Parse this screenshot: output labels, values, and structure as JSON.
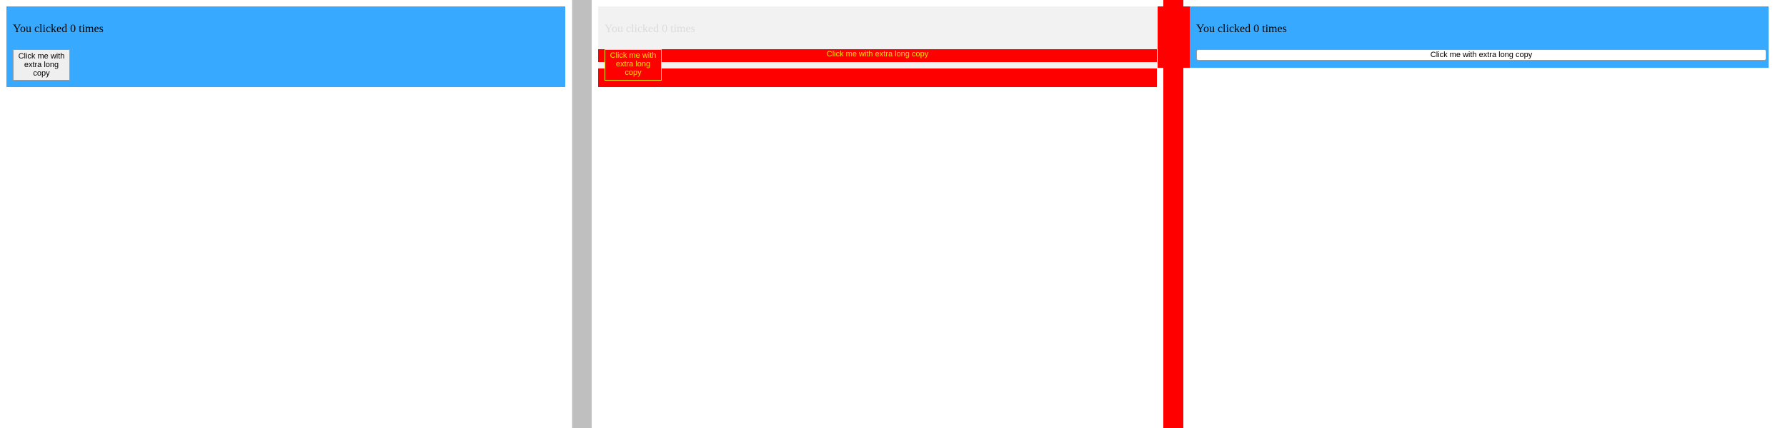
{
  "left_panel": {
    "counter_text": "You clicked 0 times",
    "button_label": "Click me with extra long copy"
  },
  "diff_panel": {
    "counter_text": "You clicked 0 times",
    "button_label_wide": "Click me with extra long copy",
    "button_label_narrow": "Click me with extra long copy"
  },
  "right_panel": {
    "counter_text": "You clicked 0 times",
    "button_label": "Click me with extra long copy"
  },
  "colors": {
    "card_blue": "#37aaff",
    "diff_red": "#ff0000",
    "diff_yellow": "#ffe000",
    "divider_gray": "#bfbfbf",
    "ghost_gray": "#f2f2f2"
  }
}
